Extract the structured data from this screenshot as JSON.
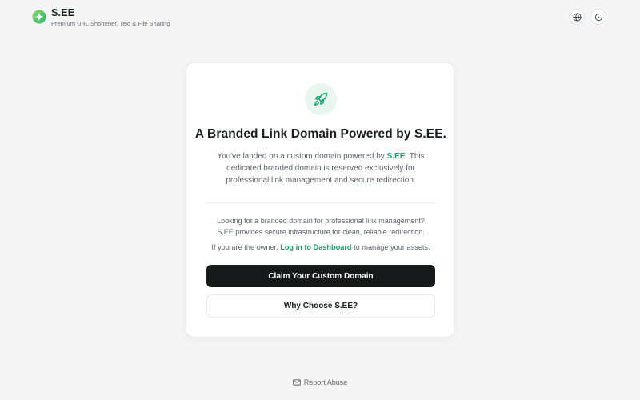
{
  "header": {
    "brand_name": "S.EE",
    "tagline": "Premium URL Shortener, Text & File Sharing",
    "logo_icon": "sparkle-logo-icon",
    "language_icon": "globe-icon",
    "theme_icon": "moon-icon"
  },
  "card": {
    "icon": "rocket-icon",
    "title": "A Branded Link Domain Powered by S.EE.",
    "intro_before": "You've landed on a custom domain powered by ",
    "intro_brand": "S.EE",
    "intro_after": ". This dedicated branded domain is reserved exclusively for professional link management and secure redirection.",
    "looking_line1": "Looking for a branded domain for professional link management?",
    "looking_line2": "S.EE provides secure infrastructure for clean, reliable redirection.",
    "owner_before": "If you are the owner, ",
    "owner_link": "Log in to Dashboard",
    "owner_after": " to manage your assets.",
    "primary_button": "Claim Your Custom Domain",
    "secondary_button": "Why Choose S.EE?"
  },
  "footer": {
    "report_label": "Report Abuse",
    "report_icon": "mail-icon"
  },
  "colors": {
    "accent": "#22a06b",
    "primary_button_bg": "#16181a",
    "page_bg": "#f4f5f4"
  }
}
